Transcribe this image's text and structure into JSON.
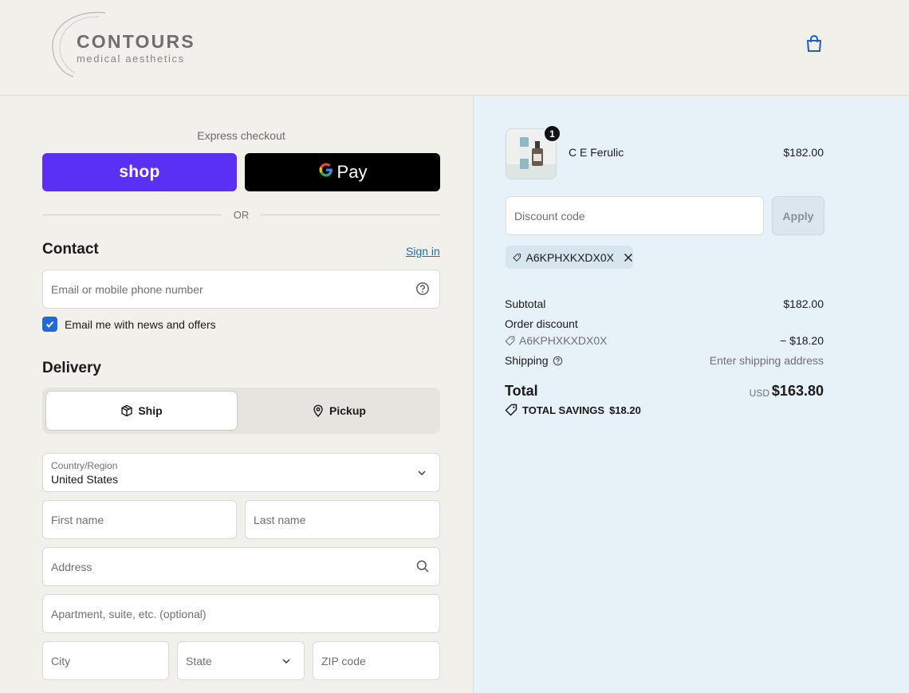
{
  "brand": {
    "name": "CONTOURS",
    "tagline": "medical aesthetics"
  },
  "express": {
    "title": "Express checkout",
    "shop_label": "shop",
    "gpay_label": "Pay",
    "gpay_letter": "G",
    "or_label": "OR"
  },
  "contact": {
    "title": "Contact",
    "sign_in": "Sign in",
    "email_placeholder": "Email or mobile phone number",
    "newsletter_label": "Email me with news and offers",
    "newsletter_checked": true
  },
  "delivery": {
    "title": "Delivery",
    "ship_label": "Ship",
    "pickup_label": "Pickup",
    "country_label": "Country/Region",
    "country_value": "United States",
    "first_name": "First name",
    "last_name": "Last name",
    "address": "Address",
    "apartment": "Apartment, suite, etc. (optional)",
    "city": "City",
    "state": "State",
    "zip": "ZIP code"
  },
  "order": {
    "item": {
      "name": "C E Ferulic",
      "price": "$182.00",
      "quantity": "1"
    },
    "discount_placeholder": "Discount code",
    "apply_label": "Apply",
    "applied_code": "A6KPHXKXDX0X",
    "subtotal_label": "Subtotal",
    "subtotal_value": "$182.00",
    "order_discount_label": "Order discount",
    "discount_code": "A6KPHXKXDX0X",
    "discount_value": "− $18.20",
    "shipping_label": "Shipping",
    "shipping_value": "Enter shipping address",
    "total_label": "Total",
    "total_currency": "USD",
    "total_value": "$163.80",
    "savings_label": "TOTAL SAVINGS",
    "savings_value": "$18.20"
  },
  "colors": {
    "shop_purple": "#5a31f4",
    "accent_blue": "#1f6ad6",
    "link_blue": "#1a6fb5",
    "summary_bg": "#e7f1f8"
  }
}
